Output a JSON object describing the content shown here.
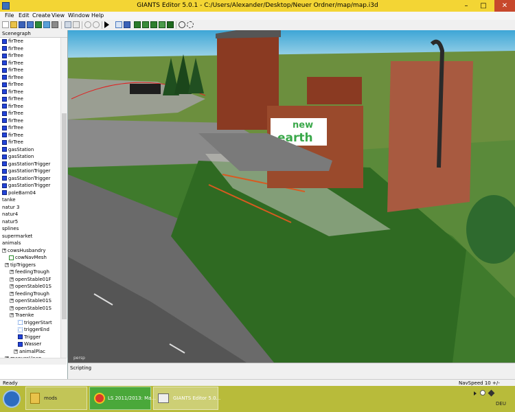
{
  "window": {
    "title": "GIANTS Editor 5.0.1 - C:/Users/Alexander/Desktop/Neuer Ordner/map/map.i3d",
    "minimize_symbol": "–",
    "maximize_symbol": "□",
    "close_symbol": "✕"
  },
  "menu": [
    {
      "label": "File"
    },
    {
      "label": "Edit"
    },
    {
      "label": "Create"
    },
    {
      "label": "View"
    },
    {
      "label": "Window"
    },
    {
      "label": "Help"
    }
  ],
  "scenegraph": {
    "title": "Scenegraph",
    "items": [
      {
        "label": "firTree",
        "icon": "cube-icon"
      },
      {
        "label": "firTree",
        "icon": "cube-icon"
      },
      {
        "label": "firTree",
        "icon": "cube-icon"
      },
      {
        "label": "firTree",
        "icon": "cube-icon"
      },
      {
        "label": "firTree",
        "icon": "cube-icon"
      },
      {
        "label": "firTree",
        "icon": "cube-icon"
      },
      {
        "label": "firTree",
        "icon": "cube-icon"
      },
      {
        "label": "firTree",
        "icon": "cube-icon"
      },
      {
        "label": "firTree",
        "icon": "cube-icon"
      },
      {
        "label": "firTree",
        "icon": "cube-icon"
      },
      {
        "label": "firTree",
        "icon": "cube-icon"
      },
      {
        "label": "firTree",
        "icon": "cube-icon"
      },
      {
        "label": "firTree",
        "icon": "cube-icon"
      },
      {
        "label": "firTree",
        "icon": "cube-icon"
      },
      {
        "label": "firTree",
        "icon": "cube-icon"
      },
      {
        "label": "gasStation",
        "icon": "cube-icon"
      },
      {
        "label": "gasStation",
        "icon": "cube-icon"
      },
      {
        "label": "gasStationTrigger",
        "icon": "cube-icon"
      },
      {
        "label": "gasStationTrigger",
        "icon": "cube-icon"
      },
      {
        "label": "gasStationTrigger",
        "icon": "cube-icon"
      },
      {
        "label": "gasStationTrigger",
        "icon": "cube-icon"
      },
      {
        "label": "poleBarn04",
        "icon": "cube-icon"
      },
      {
        "label": "tanke",
        "icon": "none"
      },
      {
        "label": "natur 3",
        "icon": "none"
      },
      {
        "label": "natur4",
        "icon": "none"
      },
      {
        "label": "natur5",
        "icon": "none"
      },
      {
        "label": "splines",
        "icon": "none"
      },
      {
        "label": "supermarket",
        "icon": "none"
      },
      {
        "label": "animals",
        "icon": "none"
      },
      {
        "label": "cowsHusbandry",
        "icon": "expand-icon"
      },
      {
        "label": "cowNavMesh",
        "icon": "mesh-icon"
      },
      {
        "label": "tipTriggers",
        "icon": "expand-icon"
      },
      {
        "label": "feedingTrough",
        "icon": "expand-icon"
      },
      {
        "label": "openStable01F",
        "icon": "expand-icon"
      },
      {
        "label": "openStable01S",
        "icon": "expand-icon"
      },
      {
        "label": "feedingTrough",
        "icon": "expand-icon"
      },
      {
        "label": "openStable01S",
        "icon": "expand-icon"
      },
      {
        "label": "openStable01S",
        "icon": "expand-icon"
      },
      {
        "label": "Traenke",
        "icon": "expand-icon"
      },
      {
        "label": "triggerStart",
        "icon": "dots-icon"
      },
      {
        "label": "triggerEnd",
        "icon": "dots-icon"
      },
      {
        "label": "Trigger",
        "icon": "cube-icon"
      },
      {
        "label": "Wasser",
        "icon": "cube-icon"
      },
      {
        "label": "animalPlac",
        "icon": "expand-icon"
      },
      {
        "label": "manureHeap",
        "icon": "expand-icon"
      }
    ]
  },
  "viewport": {
    "sign_line1": "new",
    "sign_line2": "earth",
    "camera_label": "persp"
  },
  "scripting": {
    "title": "Scripting"
  },
  "status": {
    "ready": "Ready",
    "nav_speed": "NavSpeed 10 +/-"
  },
  "taskbar": {
    "items": [
      {
        "label": "mods",
        "icon": "folder-icon"
      },
      {
        "label": "LS 2011/2013: Ma...",
        "icon": "chrome-icon"
      },
      {
        "label": "GIANTS Editor 5.0...",
        "icon": "editor-icon"
      }
    ],
    "language": "DEU"
  }
}
